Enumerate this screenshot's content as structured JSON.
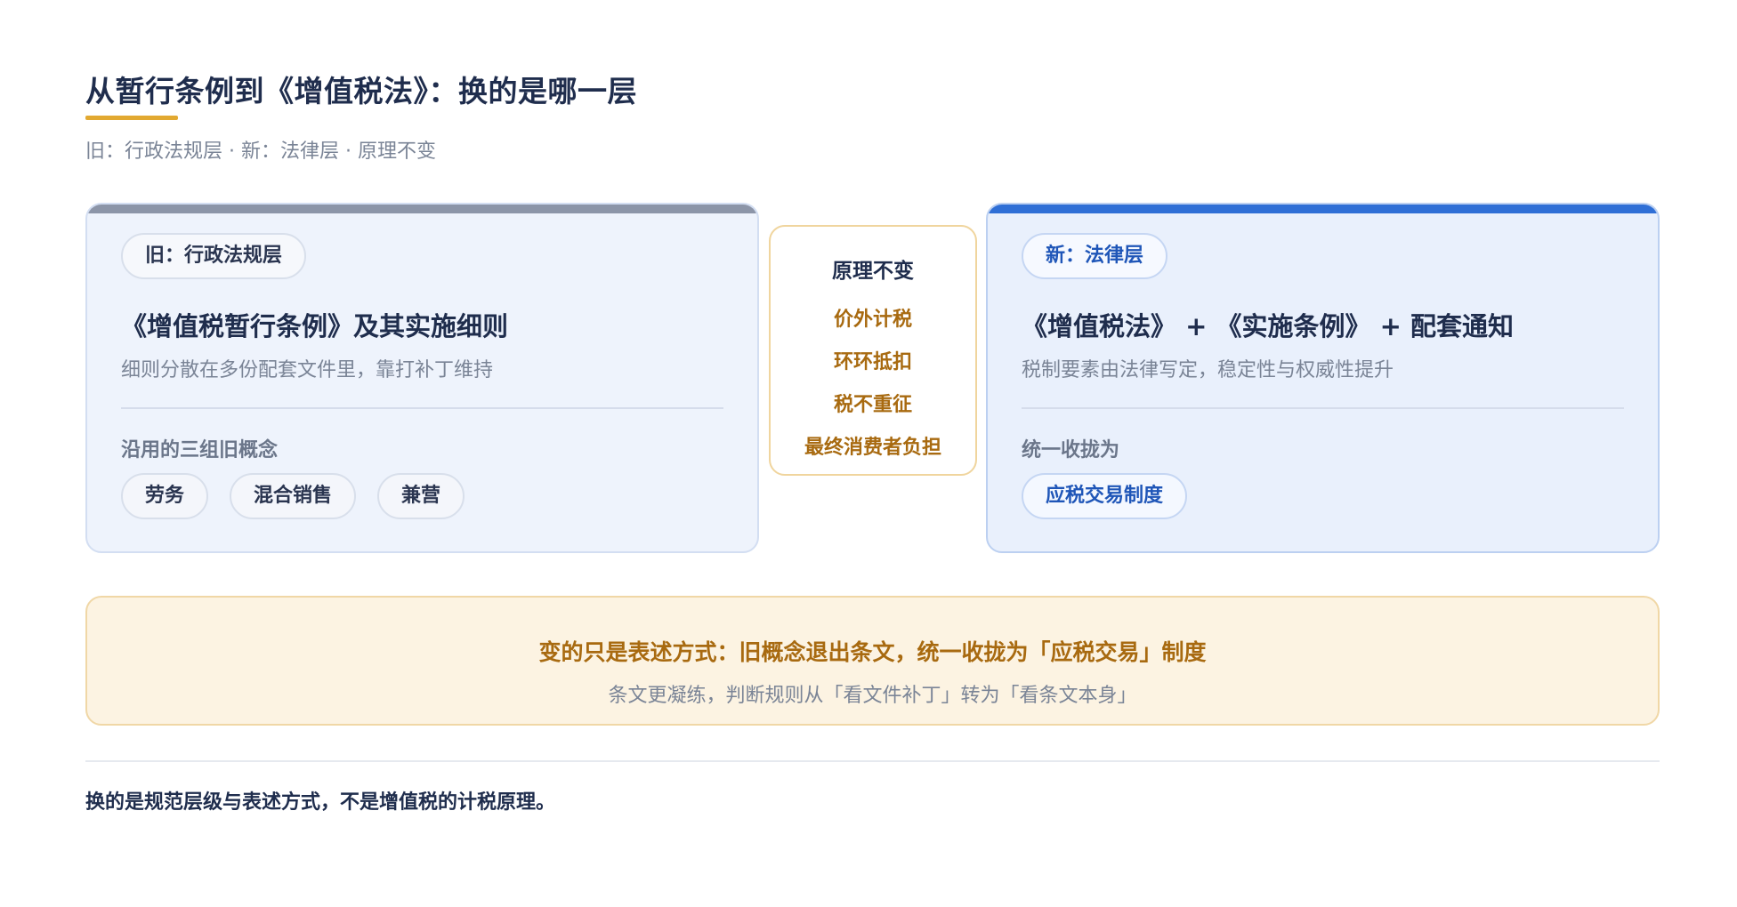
{
  "header": {
    "title": "从暂行条例到《增值税法》：换的是哪一层",
    "subtitle": "旧：行政法规层 · 新：法律层 · 原理不变"
  },
  "old_card": {
    "badge": "旧：行政法规层",
    "title": "《增值税暂行条例》及其实施细则",
    "description": "细则分散在多份配套文件里，靠打补丁维持",
    "section_label": "沿用的三组旧概念",
    "tags": [
      "劳务",
      "混合销售",
      "兼营"
    ]
  },
  "middle": {
    "title": "原理不变",
    "items": [
      "价外计税",
      "环环抵扣",
      "税不重征",
      "最终消费者负担"
    ]
  },
  "new_card": {
    "badge": "新：法律层",
    "title": "《增值税法》 + 《实施条例》 + 配套通知",
    "description": "税制要素由法律写定，稳定性与权威性提升",
    "section_label": "统一收拢为",
    "tags": [
      "应税交易制度"
    ]
  },
  "note": {
    "main": "变的只是表述方式：旧概念退出条文，统一收拢为「应税交易」制度",
    "sub": "条文更凝练，判断规则从「看文件补丁」转为「看条文本身」"
  },
  "footer": {
    "text": "换的是规范层级与表述方式，不是增值税的计税原理。"
  },
  "colors": {
    "accent_gold": "#e2a931",
    "old_bar": "#8c95a8",
    "new_bar": "#2f6fd6",
    "principle_text": "#a86a10"
  }
}
